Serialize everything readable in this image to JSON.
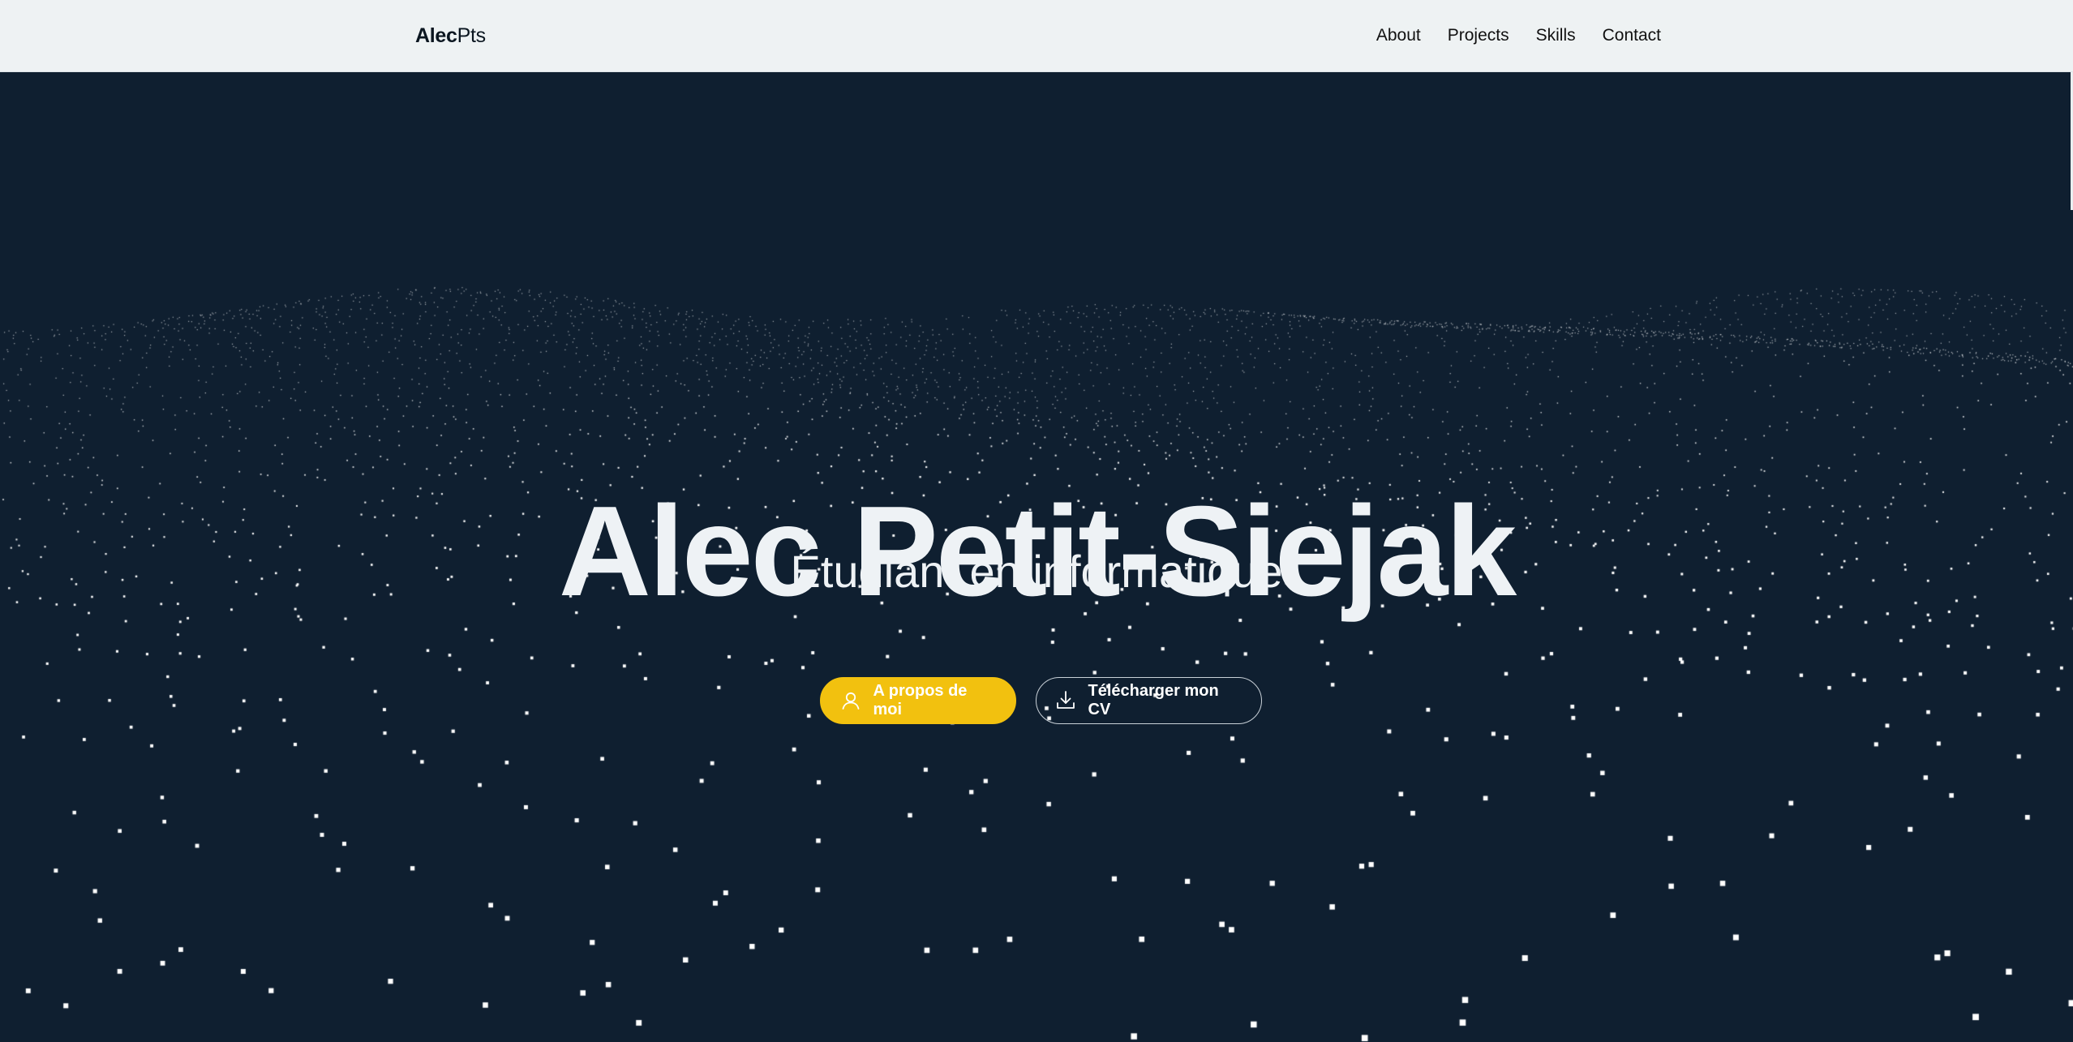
{
  "brand": {
    "bold": "Alec",
    "light": "Pts"
  },
  "nav": {
    "items": [
      {
        "label": "About"
      },
      {
        "label": "Projects"
      },
      {
        "label": "Skills"
      },
      {
        "label": "Contact"
      }
    ]
  },
  "hero": {
    "title": "Alec Petit-Siejak",
    "subtitle": "Étudiant en informatique",
    "buttons": [
      {
        "label": "A propos de moi",
        "icon": "user-icon"
      },
      {
        "label": "Télécharger mon CV",
        "icon": "download-icon"
      }
    ]
  },
  "colors": {
    "background": "#0f1f30",
    "navbar": "#eef2f3",
    "accent": "#f2c10f",
    "text_light": "#eef2f5",
    "particle": "#ffffff"
  }
}
